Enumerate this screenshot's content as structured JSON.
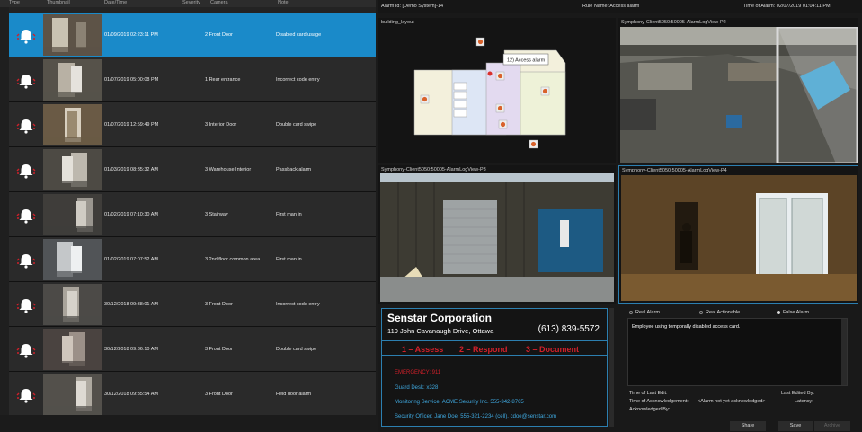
{
  "list": {
    "headers": [
      "Type",
      "Thumbnail",
      "Date/Time",
      "Severity",
      "Camera",
      "Note"
    ],
    "rows": [
      {
        "date": "01/09/2019 02:23:11 PM",
        "camera": "2  Front Door",
        "note": "Disabled card usage",
        "selected": true
      },
      {
        "date": "01/07/2019 05:00:08 PM",
        "camera": "1  Rear entrance",
        "note": "Incorrect code entry"
      },
      {
        "date": "01/07/2019 12:59:49 PM",
        "camera": "3  Interior Door",
        "note": "Double card swipe"
      },
      {
        "date": "01/03/2019 08:35:32 AM",
        "camera": "3  Warehouse Interior",
        "note": "Passback alarm"
      },
      {
        "date": "01/02/2019 07:10:30 AM",
        "camera": "3  Stairway",
        "note": "First man in"
      },
      {
        "date": "01/02/2019 07:07:52 AM",
        "camera": "3  2nd floor common area",
        "note": "First man in"
      },
      {
        "date": "30/12/2018 09:38:01 AM",
        "camera": "3  Front Door",
        "note": "Incorrect code entry"
      },
      {
        "date": "30/12/2018 09:36:10 AM",
        "camera": "3  Front Door",
        "note": "Double card swipe"
      },
      {
        "date": "30/12/2018 09:35:54 AM",
        "camera": "3  Front Door",
        "note": "Held door alarm"
      }
    ]
  },
  "topbar": {
    "alarm_id": "Alarm Id:  [Demo System]-14",
    "rule_name": "Rule Name:  Access alarm",
    "time_of_alarm": "Time of Alarm:  02/07/2019 01:04:11 PM"
  },
  "panels": {
    "layout_label": "building_layout",
    "popup": "12) Access alarm",
    "p2": "Symphony-Client5050:50005-AlarmLogView-P2",
    "p3": "Symphony-Client5050:50005-AlarmLogView-P3",
    "p4": "Symphony-Client5050:50005-AlarmLogView-P4"
  },
  "card": {
    "company": "Senstar Corporation",
    "address": "119 John Cavanaugh Drive, Ottawa",
    "phone": "(613) 839-5572",
    "steps": [
      "1 – Assess",
      "2 – Respond",
      "3 – Document"
    ],
    "emergency": "EMERGENCY: 911",
    "guard": "Guard Desk: x328",
    "monitoring": "Monitoring Service: ACME Security Inc. 555-342-8765",
    "officer": "Security Officer: Jane Doe. 555-321-2234 (cell). cdoe@senstar.com"
  },
  "notes": {
    "radios": [
      "Real Alarm",
      "Real Actionable",
      "False Alarm"
    ],
    "text": "Employee using temporally disabled access card.",
    "last_edit": "Time of Last Edit:",
    "last_edited_by": "Last Edited By:",
    "ack_time_label": "Time of Acknowledgement:",
    "ack_time_value": "<Alarm not yet acknowledged>",
    "latency": "Latency:",
    "ack_by": "Acknowledged By:",
    "share": "Share",
    "save": "Save",
    "archive": "Archive"
  },
  "colors": {
    "accent": "#1a8ac9",
    "red": "#d0202a",
    "link": "#3fa9e0"
  }
}
